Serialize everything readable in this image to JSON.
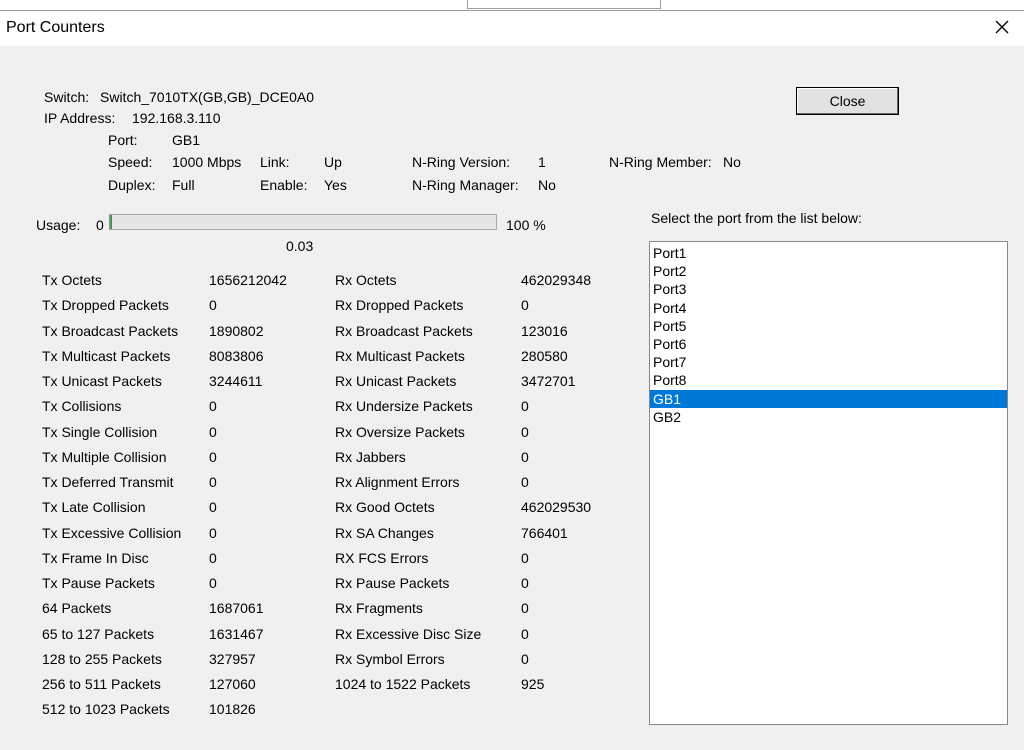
{
  "window": {
    "title": "Port Counters",
    "close_glyph": "✕"
  },
  "info": {
    "switch_label": "Switch:",
    "switch_value": "Switch_7010TX(GB,GB)_DCE0A0",
    "ip_label": "IP Address:",
    "ip_value": "192.168.3.110",
    "port_label": "Port:",
    "port_value": "GB1",
    "speed_label": "Speed:",
    "speed_value": "1000 Mbps",
    "link_label": "Link:",
    "link_value": "Up",
    "nring_version_label": "N-Ring Version:",
    "nring_version_value": "1",
    "nring_member_label": "N-Ring Member:",
    "nring_member_value": "No",
    "duplex_label": "Duplex:",
    "duplex_value": "Full",
    "enable_label": "Enable:",
    "enable_value": "Yes",
    "nring_manager_label": "N-Ring Manager:",
    "nring_manager_value": "No"
  },
  "close_button": "Close",
  "usage": {
    "label": "Usage:",
    "min": "0",
    "max": "100 %",
    "value_text": "0.03",
    "fraction": 0.0003
  },
  "counters_left": [
    {
      "label": "Tx Octets",
      "value": "1656212042"
    },
    {
      "label": "Tx Dropped Packets",
      "value": "0"
    },
    {
      "label": "Tx Broadcast Packets",
      "value": "1890802"
    },
    {
      "label": "Tx Multicast Packets",
      "value": "8083806"
    },
    {
      "label": "Tx Unicast Packets",
      "value": "3244611"
    },
    {
      "label": "Tx Collisions",
      "value": "0"
    },
    {
      "label": "Tx Single Collision",
      "value": "0"
    },
    {
      "label": "Tx Multiple Collision",
      "value": "0"
    },
    {
      "label": "Tx Deferred Transmit",
      "value": "0"
    },
    {
      "label": "Tx Late Collision",
      "value": "0"
    },
    {
      "label": "Tx Excessive Collision",
      "value": "0"
    },
    {
      "label": "Tx Frame In Disc",
      "value": "0"
    },
    {
      "label": "Tx Pause Packets",
      "value": "0"
    },
    {
      "label": "64 Packets",
      "value": "1687061"
    },
    {
      "label": "65 to 127 Packets",
      "value": "1631467"
    },
    {
      "label": "128 to 255 Packets",
      "value": "327957"
    },
    {
      "label": "256 to 511 Packets",
      "value": "127060"
    },
    {
      "label": "512 to 1023 Packets",
      "value": "101826"
    }
  ],
  "counters_right": [
    {
      "label": "Rx Octets",
      "value": "462029348"
    },
    {
      "label": "Rx Dropped Packets",
      "value": "0"
    },
    {
      "label": "Rx Broadcast Packets",
      "value": "123016"
    },
    {
      "label": "Rx Multicast Packets",
      "value": "280580"
    },
    {
      "label": "Rx Unicast Packets",
      "value": "3472701"
    },
    {
      "label": "Rx Undersize Packets",
      "value": "0"
    },
    {
      "label": "Rx Oversize Packets",
      "value": "0"
    },
    {
      "label": "Rx Jabbers",
      "value": "0"
    },
    {
      "label": "Rx Alignment Errors",
      "value": "0"
    },
    {
      "label": "Rx Good Octets",
      "value": "462029530"
    },
    {
      "label": "Rx SA Changes",
      "value": "766401"
    },
    {
      "label": "RX FCS Errors",
      "value": "0"
    },
    {
      "label": "Rx Pause Packets",
      "value": "0"
    },
    {
      "label": "Rx Fragments",
      "value": "0"
    },
    {
      "label": "Rx Excessive Disc Size",
      "value": "0"
    },
    {
      "label": "Rx Symbol Errors",
      "value": "0"
    },
    {
      "label": "1024 to 1522 Packets",
      "value": "925"
    }
  ],
  "port_list": {
    "prompt": "Select the port from the list below:",
    "items": [
      "Port1",
      "Port2",
      "Port3",
      "Port4",
      "Port5",
      "Port6",
      "Port7",
      "Port8",
      "GB1",
      "GB2"
    ],
    "selected": "GB1"
  },
  "colors": {
    "selection": "#0078d7",
    "dialog_bg": "#f0f0f0"
  }
}
